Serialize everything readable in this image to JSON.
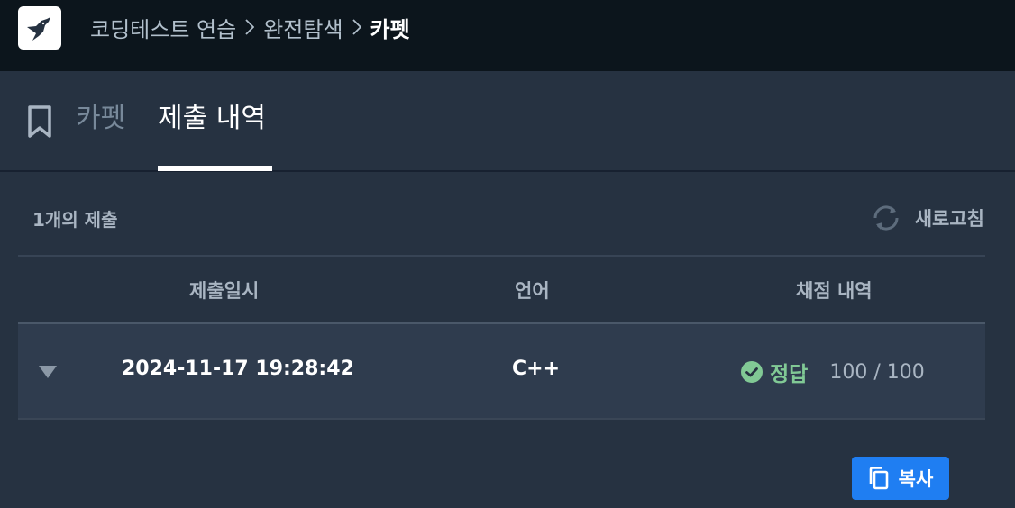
{
  "header": {
    "breadcrumb": [
      "코딩테스트 연습",
      "완전탐색",
      "카펫"
    ],
    "icons": {
      "logo": "hummingbird-logo-icon",
      "separator": "chevron-right-icon"
    }
  },
  "tabs": {
    "bookmark_icon": "bookmark-icon",
    "problem": "카펫",
    "submissions": "제출 내역",
    "active": "제출 내역"
  },
  "submissions": {
    "count_label": "1개의 제출",
    "refresh_label": "새로고침",
    "headers": {
      "submitted_at": "제출일시",
      "language": "언어",
      "grading": "채점 내역"
    },
    "rows": [
      {
        "submitted_at": "2024-11-17 19:28:42",
        "language": "C++",
        "result": "정답",
        "score": "100 / 100",
        "result_color": "#81c995"
      }
    ]
  },
  "actions": {
    "copy_label": "복사",
    "copy_icon": "copy-icon"
  },
  "colors": {
    "primary": "#1f7ef2",
    "success": "#81c995",
    "topbar": "#0c151c",
    "background": "#263241"
  }
}
